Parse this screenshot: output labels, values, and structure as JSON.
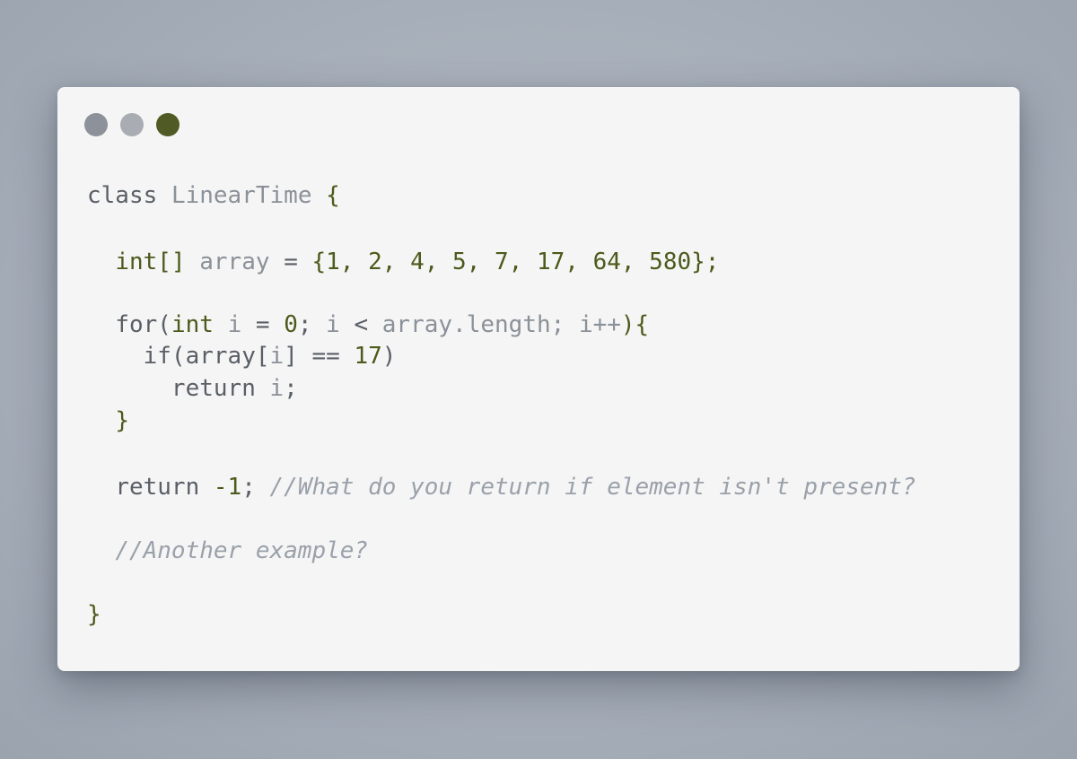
{
  "window": {
    "controls": [
      {
        "name": "close",
        "color": "#8d9199"
      },
      {
        "name": "minimize",
        "color": "#a9adb3"
      },
      {
        "name": "zoom",
        "color": "#4f5a24"
      }
    ]
  },
  "code": {
    "l1": {
      "kw": "class",
      "name": "LinearTime",
      "brace": "{"
    },
    "l2": {
      "type": "int[]",
      "name": "array",
      "eq": "=",
      "open": "{",
      "values": "1, 2, 4, 5, 7, 17, 64, 580",
      "close": "};"
    },
    "l3": {
      "kw": "for(",
      "type": "int",
      "var": "i",
      "eq": "=",
      "zero": "0",
      "semi1": ";",
      "cond_var": "i",
      "lt": "<",
      "length": "array.length;",
      "inc_var": "i++",
      "close": "){"
    },
    "l4": {
      "kw": "if(array[",
      "var": "i",
      "mid": "] ==",
      "num": "17",
      "close": ")"
    },
    "l5": {
      "kw": "return",
      "var": "i",
      "semi": ";"
    },
    "l6": {
      "brace": "}"
    },
    "l7": {
      "kw": "return",
      "num": "-1",
      "semi": ";",
      "comment": "//What do you return if element isn't present?"
    },
    "l8": {
      "comment": "//Another example?"
    },
    "l9": {
      "brace": "}"
    }
  }
}
